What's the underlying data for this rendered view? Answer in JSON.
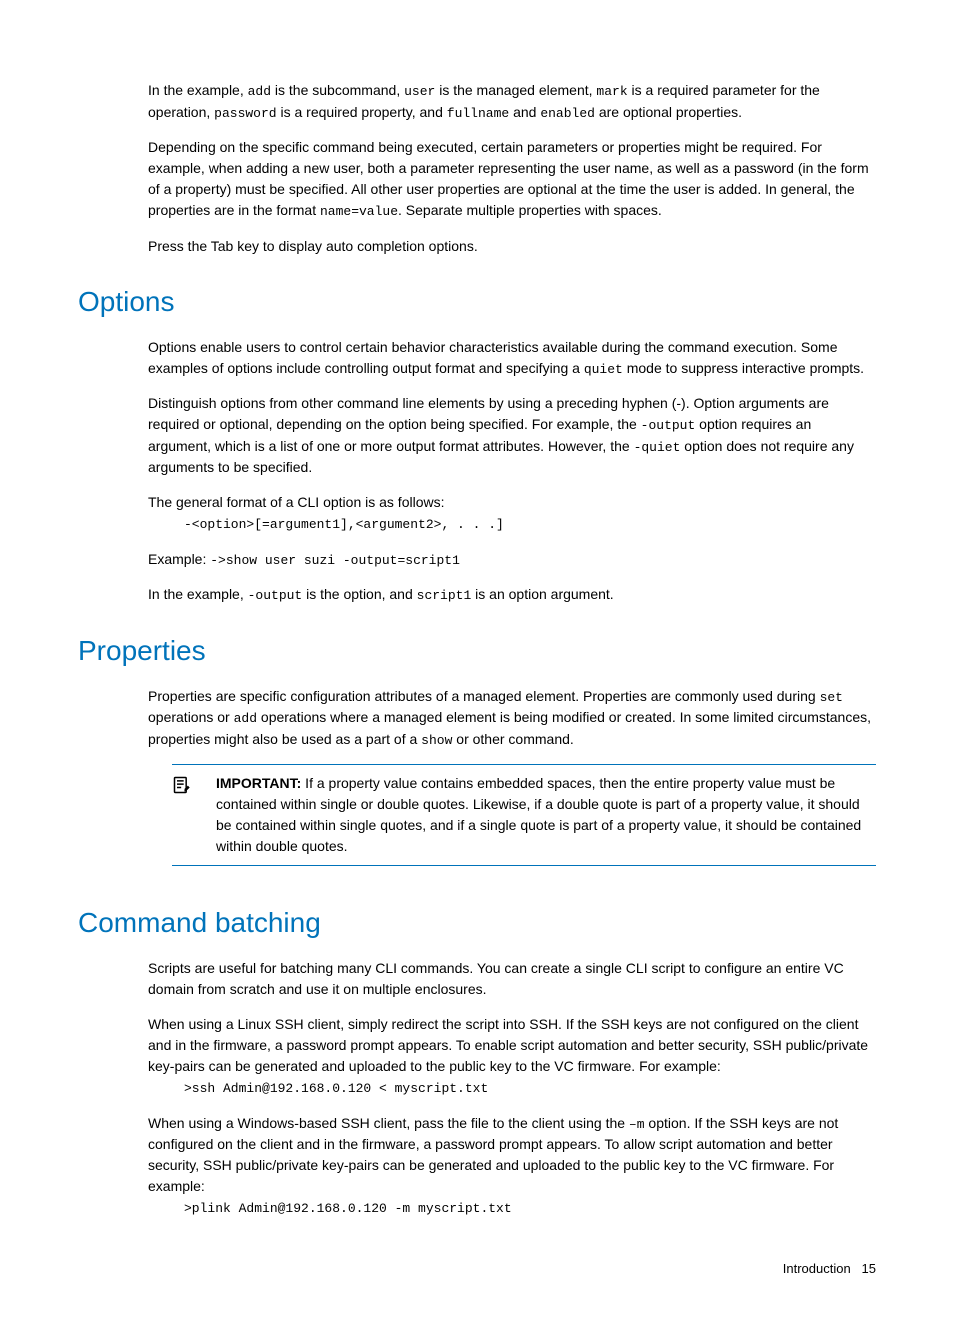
{
  "intro": {
    "p1_a": "In the example, ",
    "p1_add": "add",
    "p1_b": " is the subcommand, ",
    "p1_user": "user",
    "p1_c": " is the managed element, ",
    "p1_mark": "mark",
    "p1_d": " is a required parameter for the operation, ",
    "p1_password": "password",
    "p1_e": " is a required property, and ",
    "p1_fullname": "fullname",
    "p1_f": " and ",
    "p1_enabled": "enabled",
    "p1_g": " are optional properties.",
    "p2_a": "Depending on the specific command being executed, certain parameters or properties might be required. For example, when adding a new user, both a parameter representing the user name, as well as a password (in the form of a property) must be specified. All other user properties are optional at the time the user is added. In general, the properties are in the format ",
    "p2_code": "name=value",
    "p2_b": ". Separate multiple properties with spaces.",
    "p3": "Press the Tab key to display auto completion options."
  },
  "options": {
    "heading": "Options",
    "p1_a": "Options enable users to control certain behavior characteristics available during the command execution. Some examples of options include controlling output format and specifying a ",
    "p1_quiet": "quiet",
    "p1_b": " mode to suppress interactive prompts.",
    "p2_a": "Distinguish options from other command line elements by using a preceding hyphen (-). Option arguments are required or optional, depending on the option being specified. For example, the ",
    "p2_output": "-output",
    "p2_b": " option requires an argument, which is a list of one or more output format attributes. However, the ",
    "p2_quiet": "-quiet",
    "p2_c": " option does not require any arguments to be specified.",
    "p3": "The general format of a CLI option is as follows:",
    "code1": "-<option>[=argument1],<argument2>, . . .]",
    "p4_a": "Example: ",
    "p4_code": "->show user suzi -output=script1",
    "p5_a": "In the example, ",
    "p5_output": "-output",
    "p5_b": " is the option, and ",
    "p5_script1": "script1",
    "p5_c": " is an option argument."
  },
  "properties": {
    "heading": "Properties",
    "p1_a": "Properties are specific configuration attributes of a managed element. Properties are commonly used during ",
    "p1_set": "set",
    "p1_b": " operations or ",
    "p1_add": "add",
    "p1_c": " operations where a managed element is being modified or created. In some limited circumstances, properties might also be used as a part of a ",
    "p1_show": "show",
    "p1_d": " or other command.",
    "callout_label": "IMPORTANT:",
    "callout_text": "   If a property value contains embedded spaces, then the entire property value must be contained within single or double quotes. Likewise, if a double quote is part of a property value, it should be contained within single quotes, and if a single quote is part of a property value, it should be contained within double quotes."
  },
  "batching": {
    "heading": "Command batching",
    "p1": "Scripts are useful for batching many CLI commands. You can create a single CLI script to configure an entire VC domain from scratch and use it on multiple enclosures.",
    "p2": "When using a Linux SSH client, simply redirect the script into SSH. If the SSH keys are not configured on the client and in the firmware, a password prompt appears. To enable script automation and better security, SSH public/private key-pairs can be generated and uploaded to the public key to the VC firmware. For example:",
    "code1": ">ssh Admin@192.168.0.120 < myscript.txt",
    "p3_a": "When using a Windows-based SSH client, pass the file to the client using the ",
    "p3_m": "–m",
    "p3_b": " option. If the SSH keys are not configured on the client and in the firmware, a password prompt appears. To allow script automation and better security, SSH public/private key-pairs can be generated and uploaded to the public key to the VC firmware. For example:",
    "code2": ">plink Admin@192.168.0.120 -m myscript.txt"
  },
  "footer": {
    "section": "Introduction",
    "page": "15"
  }
}
